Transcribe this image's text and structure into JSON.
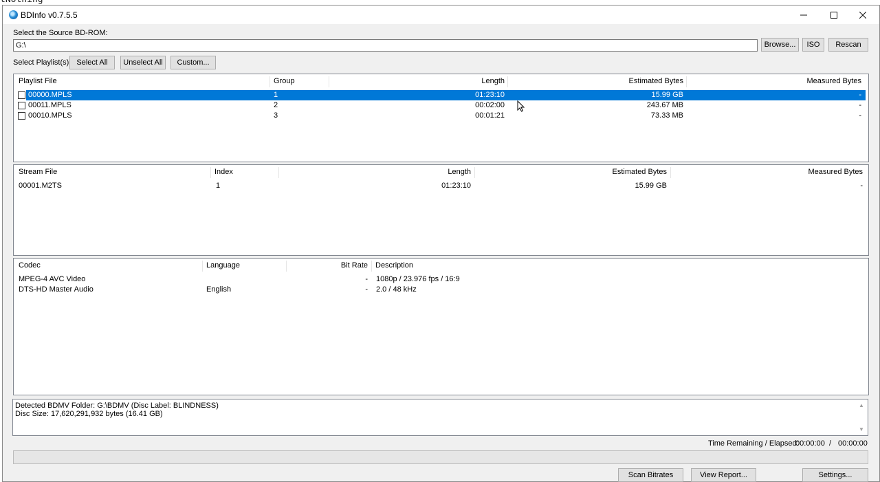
{
  "background": {
    "top_text": "tNothing"
  },
  "window": {
    "title": "BDInfo v0.7.5.5"
  },
  "source": {
    "label": "Select the Source BD-ROM:",
    "path": "G:\\",
    "browse_label": "Browse...",
    "iso_label": "ISO",
    "rescan_label": "Rescan"
  },
  "playlists_bar": {
    "label": "Select Playlist(s):",
    "select_all": "Select All",
    "unselect_all": "Unselect All",
    "custom": "Custom..."
  },
  "playlists": {
    "headers": {
      "file": "Playlist File",
      "group": "Group",
      "length": "Length",
      "est": "Estimated Bytes",
      "meas": "Measured Bytes"
    },
    "rows": [
      {
        "file": "00000.MPLS",
        "group": "1",
        "length": "01:23:10",
        "est": "15.99 GB",
        "meas": "-",
        "selected": true
      },
      {
        "file": "00011.MPLS",
        "group": "2",
        "length": "00:02:00",
        "est": "243.67 MB",
        "meas": "-",
        "selected": false
      },
      {
        "file": "00010.MPLS",
        "group": "3",
        "length": "00:01:21",
        "est": "73.33 MB",
        "meas": "-",
        "selected": false
      }
    ]
  },
  "streams": {
    "headers": {
      "file": "Stream File",
      "index": "Index",
      "length": "Length",
      "est": "Estimated Bytes",
      "meas": "Measured Bytes"
    },
    "rows": [
      {
        "file": "00001.M2TS",
        "index": "1",
        "length": "01:23:10",
        "est": "15.99 GB",
        "meas": "-"
      }
    ]
  },
  "codecs": {
    "headers": {
      "codec": "Codec",
      "language": "Language",
      "bitrate": "Bit Rate",
      "description": "Description"
    },
    "rows": [
      {
        "codec": "MPEG-4 AVC Video",
        "language": "",
        "bitrate": "-",
        "description": "1080p / 23.976 fps / 16:9"
      },
      {
        "codec": "DTS-HD Master Audio",
        "language": "English",
        "bitrate": "-",
        "description": "2.0 / 48 kHz"
      }
    ]
  },
  "log": {
    "line1": "Detected BDMV Folder: G:\\BDMV (Disc Label: BLINDNESS)",
    "line2": "Disc Size: 17,620,291,932 bytes (16.41 GB)"
  },
  "status": {
    "time_label": "Time Remaining / Elapsed:",
    "remaining": "00:00:00",
    "separator": "/",
    "elapsed": "00:00:00",
    "progress": 0
  },
  "actions": {
    "scan": "Scan Bitrates",
    "report": "View Report...",
    "settings": "Settings..."
  }
}
